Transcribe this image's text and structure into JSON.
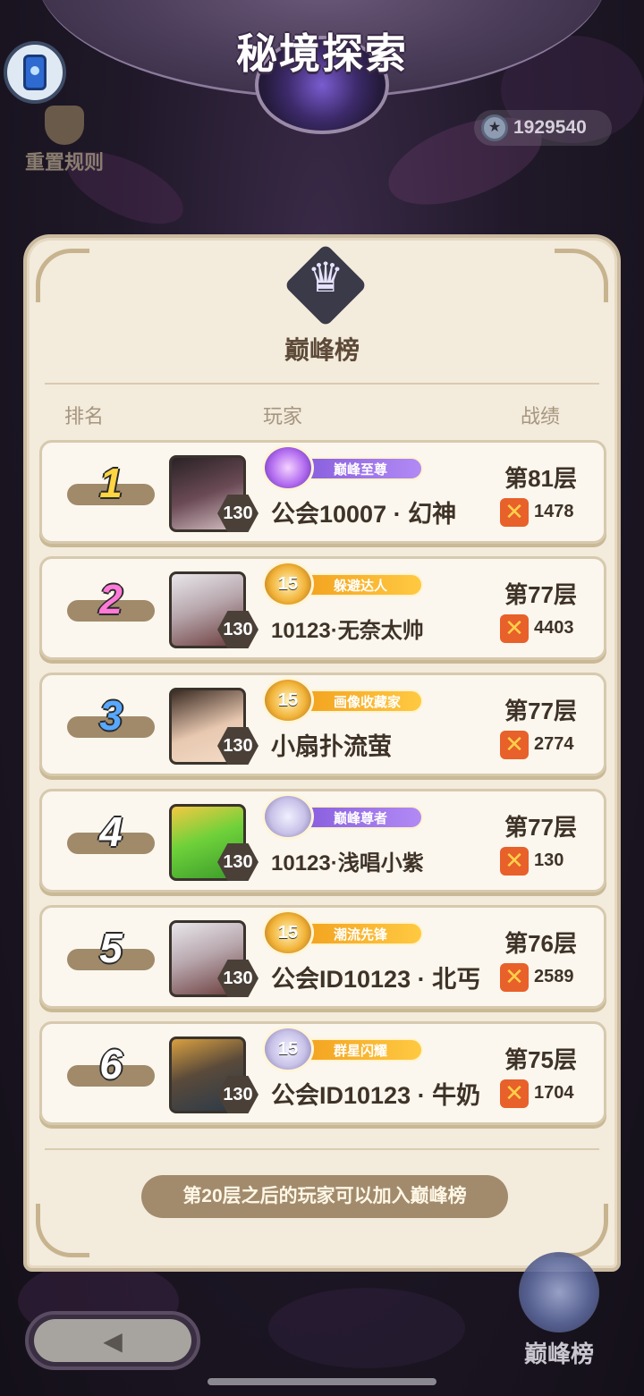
{
  "header": {
    "title": "秘境探索"
  },
  "reset_rules": {
    "label": "重置规则"
  },
  "currency": {
    "value": "1929540"
  },
  "board": {
    "title": "巅峰榜"
  },
  "columns": {
    "rank": "排名",
    "player": "玩家",
    "record": "战绩"
  },
  "rows": [
    {
      "rank": "1",
      "level": "130",
      "title": "巅峰至尊",
      "title_emblem": "",
      "name": "公会10007 · 幻神",
      "floor": "第81层",
      "score": "1478"
    },
    {
      "rank": "2",
      "level": "130",
      "title": "躲避达人",
      "title_emblem": "15",
      "name": "10123·无奈太帅",
      "floor": "第77层",
      "score": "4403"
    },
    {
      "rank": "3",
      "level": "130",
      "title": "画像收藏家",
      "title_emblem": "15",
      "name": "小扇扑流萤",
      "floor": "第77层",
      "score": "2774"
    },
    {
      "rank": "4",
      "level": "130",
      "title": "巅峰尊者",
      "title_emblem": "",
      "name": "10123·浅唱小紫",
      "floor": "第77层",
      "score": "130"
    },
    {
      "rank": "5",
      "level": "130",
      "title": "潮流先锋",
      "title_emblem": "15",
      "name": "公会ID10123 · 北丐",
      "floor": "第76层",
      "score": "2589"
    },
    {
      "rank": "6",
      "level": "130",
      "title": "群星闪耀",
      "title_emblem": "15",
      "name": "公会ID10123 · 牛奶",
      "floor": "第75层",
      "score": "1704"
    }
  ],
  "join_hint": "第20层之后的玩家可以加入巅峰榜",
  "peak_button": {
    "label": "巅峰榜"
  },
  "colors": {
    "panel": "#f3ebdc",
    "accent_purple": "#9a6ae8",
    "accent_gold": "#f4b030",
    "score_icon": "#e8602a"
  }
}
